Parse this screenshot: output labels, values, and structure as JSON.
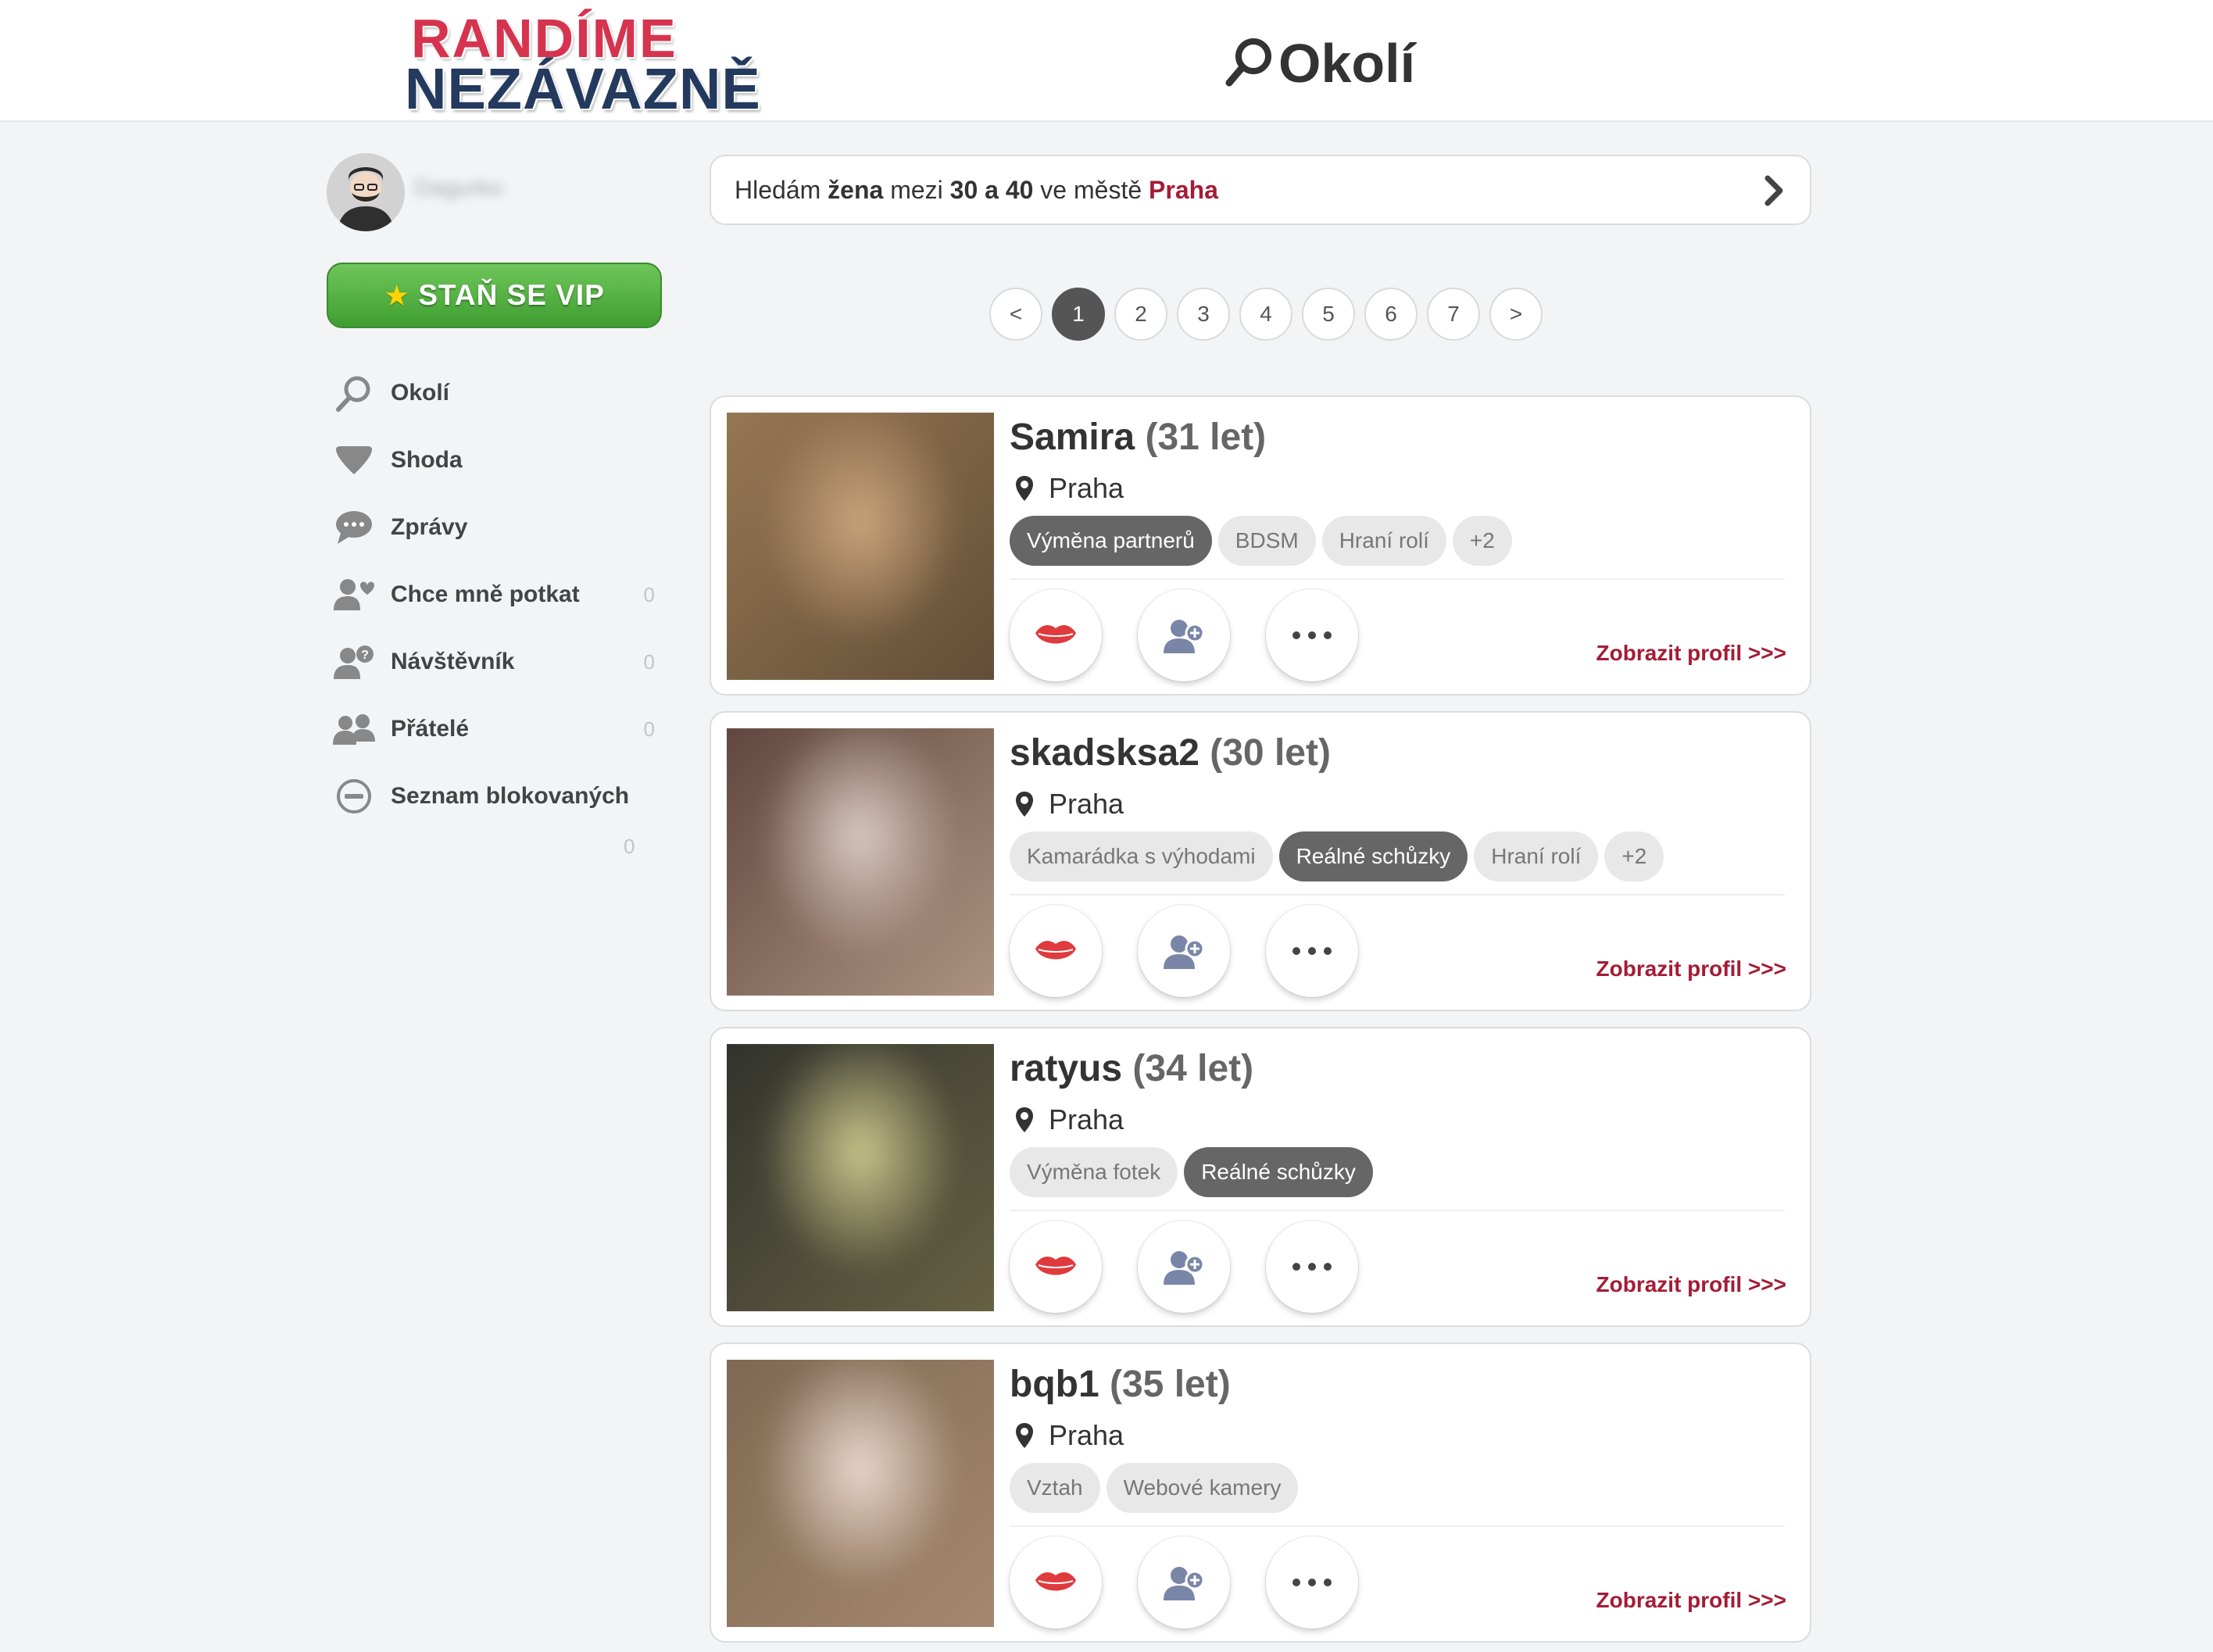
{
  "header": {
    "logo_line1": "RANDÍME",
    "logo_line2": "NEZÁVAZNĚ",
    "page_title": "Okolí"
  },
  "sidebar": {
    "username": "Dagurko",
    "vip_label": "STAŇ SE VIP",
    "items": [
      {
        "label": "Okolí",
        "icon": "search-icon",
        "count": ""
      },
      {
        "label": "Shoda",
        "icon": "heart-icon",
        "count": ""
      },
      {
        "label": "Zprávy",
        "icon": "chat-bubble-icon",
        "count": ""
      },
      {
        "label": "Chce mně potkat",
        "icon": "user-heart-icon",
        "count": "0"
      },
      {
        "label": "Návštěvník",
        "icon": "user-question-icon",
        "count": "0"
      },
      {
        "label": "Přátelé",
        "icon": "users-icon",
        "count": "0"
      },
      {
        "label": "Seznam blokovaných",
        "icon": "block-icon",
        "count": ""
      }
    ],
    "extra_count": "0"
  },
  "search": {
    "prefix": "Hledám",
    "gender": "žena",
    "between": "mezi",
    "age_from": "30",
    "and": "a",
    "age_to": "40",
    "in_city": "ve městě",
    "city": "Praha"
  },
  "pagination": {
    "prev": "<",
    "pages": [
      "1",
      "2",
      "3",
      "4",
      "5",
      "6",
      "7"
    ],
    "active_page": "1",
    "next": ">"
  },
  "profiles": [
    {
      "nick": "Samira",
      "age": "(31 let)",
      "city": "Praha",
      "tags": [
        {
          "label": "Výměna partnerů",
          "highlighted": true
        },
        {
          "label": "BDSM",
          "highlighted": false
        },
        {
          "label": "Hraní rolí",
          "highlighted": false
        },
        {
          "label": "+2",
          "highlighted": false
        }
      ],
      "profile_link": "Zobrazit profil >>>",
      "photo_colors": [
        "#9a7a55",
        "#c9a47a",
        "#5e4a35"
      ]
    },
    {
      "nick": "skadsksa2",
      "age": "(30 let)",
      "city": "Praha",
      "tags": [
        {
          "label": "Kamarádka s výhodami",
          "highlighted": false
        },
        {
          "label": "Reálné schůzky",
          "highlighted": true
        },
        {
          "label": "Hraní rolí",
          "highlighted": false
        },
        {
          "label": "+2",
          "highlighted": false
        }
      ],
      "profile_link": "Zobrazit profil >>>",
      "photo_colors": [
        "#5a4038",
        "#d9c8c0",
        "#b39a86"
      ]
    },
    {
      "nick": "ratyus",
      "age": "(34 let)",
      "city": "Praha",
      "tags": [
        {
          "label": "Výměna fotek",
          "highlighted": false
        },
        {
          "label": "Reálné schůzky",
          "highlighted": true
        }
      ],
      "profile_link": "Zobrazit profil >>>",
      "photo_colors": [
        "#2d2f2a",
        "#c9c48a",
        "#6b6545"
      ]
    },
    {
      "nick": "bqb1",
      "age": "(35 let)",
      "city": "Praha",
      "tags": [
        {
          "label": "Vztah",
          "highlighted": false
        },
        {
          "label": "Webové kamery",
          "highlighted": false
        }
      ],
      "profile_link": "Zobrazit profil >>>",
      "photo_colors": [
        "#7c6650",
        "#e9d7cc",
        "#a88a70"
      ]
    }
  ],
  "colors": {
    "accent_red": "#a41c35",
    "logo_red": "#d6334f",
    "logo_navy": "#233a5e",
    "vip_green": "#4fb03f",
    "kiss_red": "#e03a3e",
    "friend_icon": "#7a86a8"
  }
}
